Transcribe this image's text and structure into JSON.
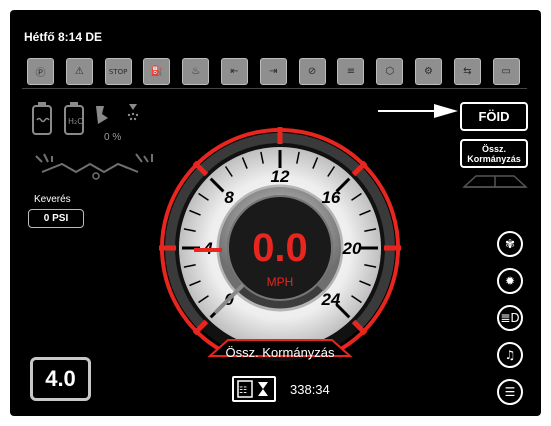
{
  "status_bar": {
    "datetime": "Hétfő 8:14 DE"
  },
  "warning_icons": [
    {
      "name": "parking-brake-icon",
      "glyph": "Ⓟ"
    },
    {
      "name": "warning-triangle-icon",
      "glyph": "⚠"
    },
    {
      "name": "stop-icon",
      "glyph": "STOP"
    },
    {
      "name": "tank-level-icon",
      "glyph": "⛽"
    },
    {
      "name": "coolant-temp-icon",
      "glyph": "♨"
    },
    {
      "name": "boom-left-icon",
      "glyph": "⇤"
    },
    {
      "name": "boom-right-icon",
      "glyph": "⇥"
    },
    {
      "name": "nozzle-off-icon",
      "glyph": "⊘"
    },
    {
      "name": "hydraulic-icon",
      "glyph": "≡"
    },
    {
      "name": "engine-icon",
      "glyph": "⬡"
    },
    {
      "name": "oil-pressure-icon",
      "glyph": "⚙"
    },
    {
      "name": "transmission-icon",
      "glyph": "⇆"
    },
    {
      "name": "battery-warning-icon",
      "glyph": "▭"
    }
  ],
  "speedometer": {
    "value": "0.0",
    "unit": "MPH",
    "ticks": [
      "0",
      "4",
      "8",
      "12",
      "16",
      "20",
      "24"
    ],
    "label": "Össz. Kormányzás",
    "min": 0,
    "max": 24,
    "current": 0
  },
  "left_panel": {
    "tank_percent": "0 %",
    "agitation_label": "Keverés",
    "agitation_value": "0 PSI",
    "rate_display": "4.0"
  },
  "right_panel": {
    "ground_button": "FÖID",
    "steering_button_line1": "Össz.",
    "steering_button_line2": "Kormányzás"
  },
  "bottom": {
    "timer_value": "338:34"
  },
  "side_buttons": [
    {
      "name": "fan-button",
      "glyph": "✾"
    },
    {
      "name": "light-button",
      "glyph": "✹"
    },
    {
      "name": "headlight-button",
      "glyph": "≣D"
    },
    {
      "name": "music-button",
      "glyph": "♫"
    },
    {
      "name": "menu-button",
      "glyph": "☰"
    }
  ],
  "colors": {
    "accent_red": "#e8251f",
    "icon_gray": "#8f8f8f",
    "background": "#000000"
  }
}
